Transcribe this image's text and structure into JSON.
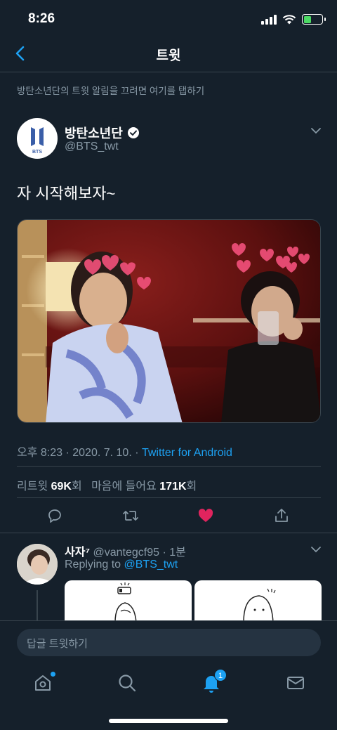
{
  "status_bar": {
    "time": "8:26"
  },
  "header": {
    "title": "트윗"
  },
  "notification_hint": "방탄소년단의 트윗 알림을 끄려면 여기를 탭하기",
  "tweet": {
    "display_name": "방탄소년단",
    "handle": "@BTS_twt",
    "avatar_text": "BTS",
    "text": "자 시작해보자~",
    "timestamp": "오후 8:23 · 2020. 7. 10. · ",
    "source": "Twitter for Android",
    "retweets_label": "리트윗",
    "retweets_count": "69K",
    "retweets_suffix": "회",
    "likes_label": "마음에 들어요",
    "likes_count": "171K",
    "likes_suffix": "회",
    "liked": true
  },
  "reply": {
    "name": "사자⁷",
    "handle": "@vantegcf95",
    "time": "· 1분",
    "replying_label": "Replying to ",
    "replying_to": "@BTS_twt"
  },
  "composer": {
    "placeholder": "답글 트윗하기"
  },
  "tabs": {
    "notifications_badge": "1"
  },
  "colors": {
    "background": "#15202b",
    "accent": "#1da1f2",
    "secondary_text": "#8899a6",
    "like": "#e0245e",
    "divider": "#38444d"
  },
  "icons": [
    "back-icon",
    "verified-icon",
    "chevron-down-icon",
    "reply-icon",
    "retweet-icon",
    "like-icon",
    "share-icon",
    "home-icon",
    "search-icon",
    "notifications-icon",
    "messages-icon"
  ]
}
